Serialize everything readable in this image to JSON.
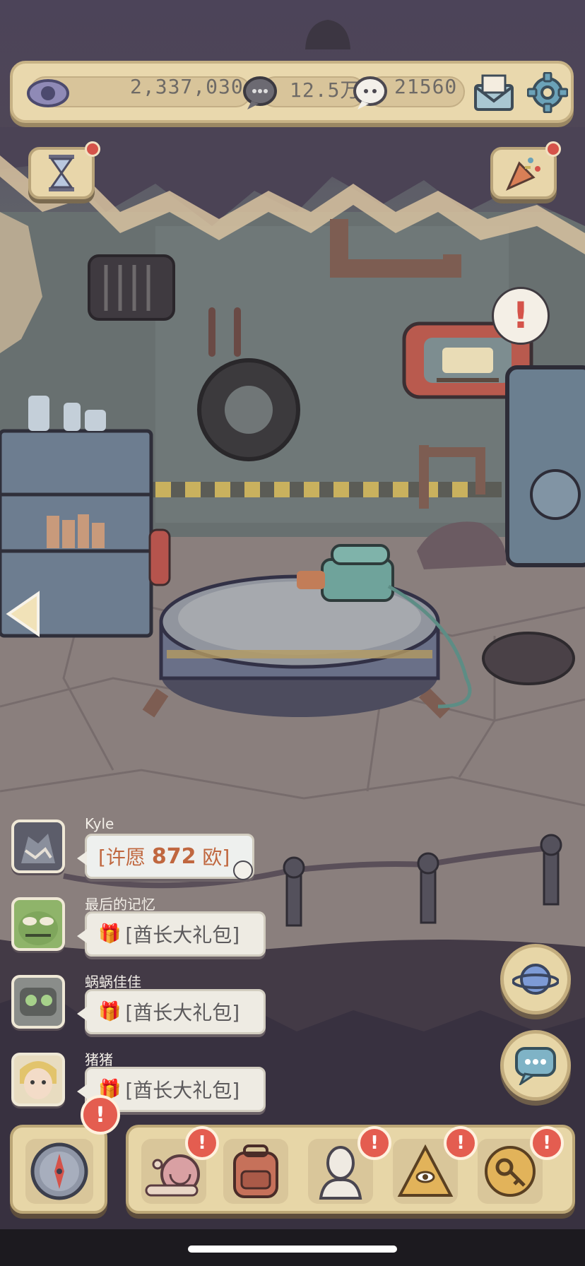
{
  "resources": {
    "eye_amount": "2,337,030",
    "gray_chat_amount": "12.5万",
    "white_chat_amount": "21560"
  },
  "icons": {
    "eye": "eye-icon",
    "gray_chat": "speech-bubble-icon",
    "white_chat": "ghost-bubble-icon",
    "mail": "mail-icon",
    "settings": "gear-icon",
    "hourglass": "hourglass-icon",
    "party": "party-popper-icon",
    "bed_sign": "bed-icon",
    "alert": "!",
    "left_arrow": "chevron-left-icon",
    "planet": "planet-icon",
    "chat": "chat-icon",
    "compass": "compass-icon",
    "snail": "snail-icon",
    "backpack": "backpack-icon",
    "bust": "statue-bust-icon",
    "pyramid": "pyramid-eye-icon",
    "key": "key-icon"
  },
  "chat": [
    {
      "name": "Kyle",
      "msg_prefix": "[许愿 ",
      "msg_amount": "872",
      "msg_suffix": " 欧]"
    },
    {
      "name": "最后的记忆",
      "msg": "[酋长大礼包]"
    },
    {
      "name": "蜗蜗佳佳",
      "msg": "[酋长大礼包]"
    },
    {
      "name": "猪猪",
      "msg": "[酋长大礼包]"
    }
  ],
  "colors": {
    "panel": "#e9d8ad",
    "alert_red": "#e45d50",
    "wish_amount": "#c0673f"
  }
}
